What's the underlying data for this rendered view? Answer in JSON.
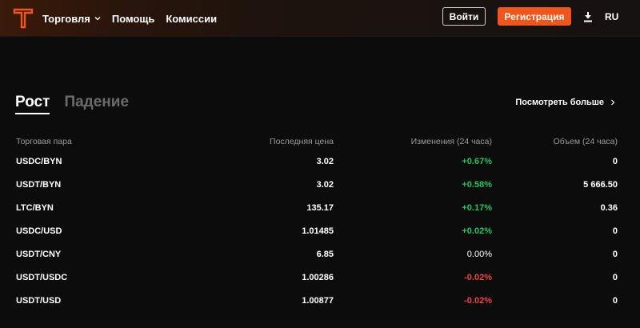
{
  "header": {
    "nav": [
      {
        "label": "Торговля",
        "has_dropdown": true
      },
      {
        "label": "Помощь",
        "has_dropdown": false
      },
      {
        "label": "Комиссии",
        "has_dropdown": false
      }
    ],
    "login_label": "Войти",
    "register_label": "Регистрация",
    "download_icon": "download-icon",
    "language": "RU",
    "accent_color": "#f0561b"
  },
  "tabs": [
    {
      "label": "Рост",
      "active": true
    },
    {
      "label": "Падение",
      "active": false
    }
  ],
  "see_more_label": "Посмотреть больше",
  "table": {
    "columns": {
      "pair": "Торговая пара",
      "price": "Последняя цена",
      "change": "Изменения (24 часа)",
      "volume": "Объем (24 часа)"
    },
    "rows": [
      {
        "pair": "USDC/BYN",
        "price": "3.02",
        "change": "+0.67%",
        "trend": "pos",
        "volume": "0"
      },
      {
        "pair": "USDT/BYN",
        "price": "3.02",
        "change": "+0.58%",
        "trend": "pos",
        "volume": "5 666.50"
      },
      {
        "pair": "LTC/BYN",
        "price": "135.17",
        "change": "+0.17%",
        "trend": "pos",
        "volume": "0.36"
      },
      {
        "pair": "USDC/USD",
        "price": "1.01485",
        "change": "+0.02%",
        "trend": "pos",
        "volume": "0"
      },
      {
        "pair": "USDT/CNY",
        "price": "6.85",
        "change": "0.00%",
        "trend": "neu",
        "volume": "0"
      },
      {
        "pair": "USDT/USDC",
        "price": "1.00286",
        "change": "-0.02%",
        "trend": "neg",
        "volume": "0"
      },
      {
        "pair": "USDT/USD",
        "price": "1.00877",
        "change": "-0.02%",
        "trend": "neg",
        "volume": "0"
      }
    ]
  }
}
